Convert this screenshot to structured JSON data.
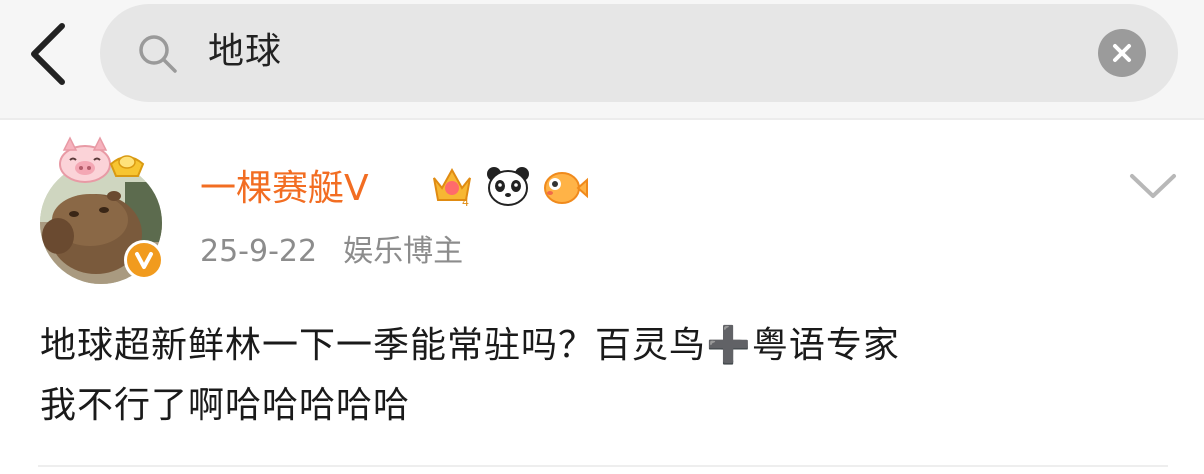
{
  "search": {
    "query": "地球"
  },
  "post": {
    "username": "一棵赛艇V",
    "date": "25-9-22",
    "category": "娱乐博主",
    "content_line1": "地球超新鲜林一下一季能常驻吗？百灵鸟➕粤语专家",
    "content_line2": "我不行了啊哈哈哈哈哈",
    "badges": [
      "crown-level-4-icon",
      "panda-icon",
      "pufferfish-icon"
    ]
  },
  "colors": {
    "username": "#f26d22",
    "verified_badge": "#f19b1e",
    "meta_text": "#8c8c8c",
    "search_bg": "#e6e6e6"
  },
  "icons": [
    "back-arrow-icon",
    "search-icon",
    "clear-icon",
    "verified-v-icon",
    "chevron-down-icon"
  ]
}
